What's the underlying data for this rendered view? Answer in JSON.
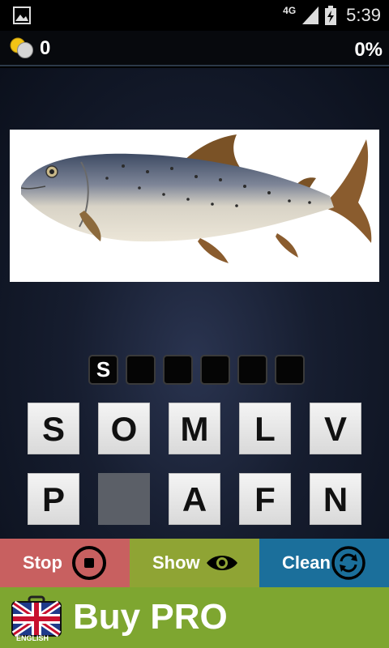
{
  "status_bar": {
    "network": "4G",
    "time": "5:39"
  },
  "score_bar": {
    "coins": "0",
    "progress_percent": "0%"
  },
  "puzzle": {
    "picture": "salmon fish",
    "answer_slots": [
      "S",
      "",
      "",
      "",
      "",
      ""
    ]
  },
  "letters": [
    [
      "S",
      "O",
      "M",
      "L",
      "V"
    ],
    [
      "P",
      "",
      "A",
      "F",
      "N"
    ]
  ],
  "actions": {
    "stop": "Stop",
    "show": "Show",
    "clean": "Clean"
  },
  "banner": {
    "text": "Buy PRO",
    "language": "ENGLISH"
  },
  "colors": {
    "stop": "#c86060",
    "show": "#8fa434",
    "clean": "#1b6f9b",
    "banner": "#7ea630"
  }
}
